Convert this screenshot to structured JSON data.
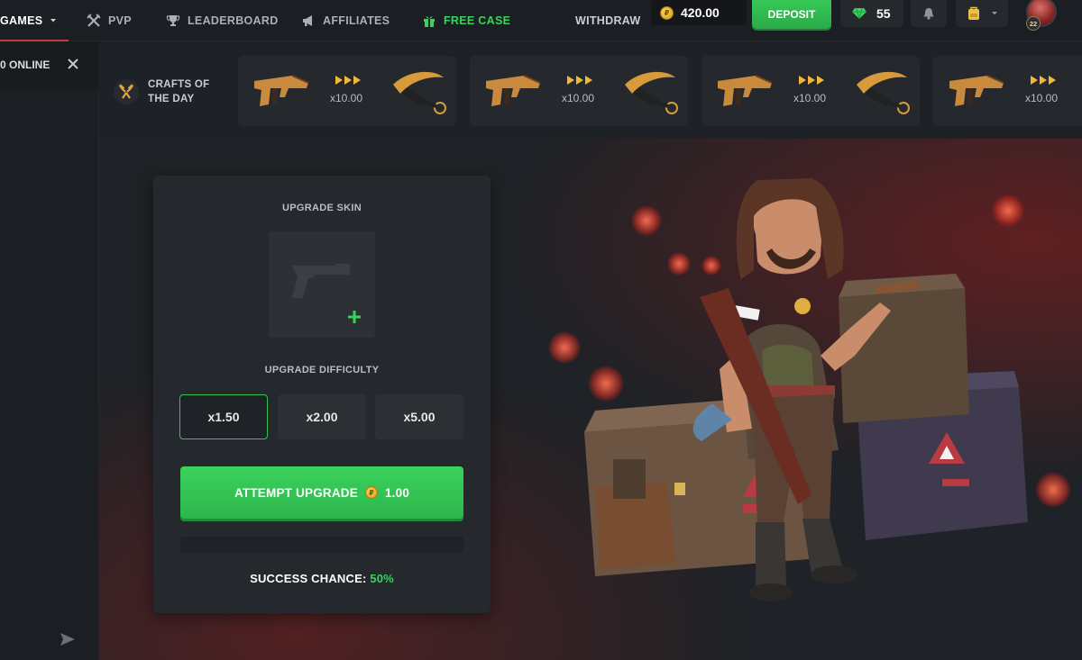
{
  "nav": {
    "games": "GAMES",
    "pvp": "PVP",
    "leaderboard": "LEADERBOARD",
    "affiliates": "AFFILIATES",
    "free_case": "FREE CASE",
    "withdraw": "WITHDRAW",
    "balance": "420.00",
    "deposit": "DEPOSIT",
    "gems": "55",
    "avatar_level": "22"
  },
  "sidebar": {
    "online": "0 ONLINE"
  },
  "crafts": {
    "title_line1": "CRAFTS OF",
    "title_line2": "THE DAY",
    "cards": [
      {
        "multiplier": "x10.00"
      },
      {
        "multiplier": "x10.00"
      },
      {
        "multiplier": "x10.00"
      },
      {
        "multiplier": "x10.00"
      }
    ]
  },
  "upgrade": {
    "skin_title": "UPGRADE SKIN",
    "difficulty_title": "UPGRADE DIFFICULTY",
    "difficulties": [
      "x1.50",
      "x2.00",
      "x5.00"
    ],
    "selected_difficulty": "x1.50",
    "attempt_label": "ATTEMPT UPGRADE",
    "attempt_cost": "1.00",
    "chance_label": "SUCCESS CHANCE:",
    "chance_value": "50%"
  },
  "colors": {
    "accent_green": "#37d45b",
    "panel": "#25282d",
    "background": "#1e2125"
  },
  "icons": {
    "pvp": "crossed-swords-icon",
    "leaderboard": "trophy-icon",
    "affiliates": "megaphone-icon",
    "free_case": "gift-icon",
    "gems": "gem-icon",
    "notifications": "bell-icon",
    "inventory": "backpack-icon"
  }
}
